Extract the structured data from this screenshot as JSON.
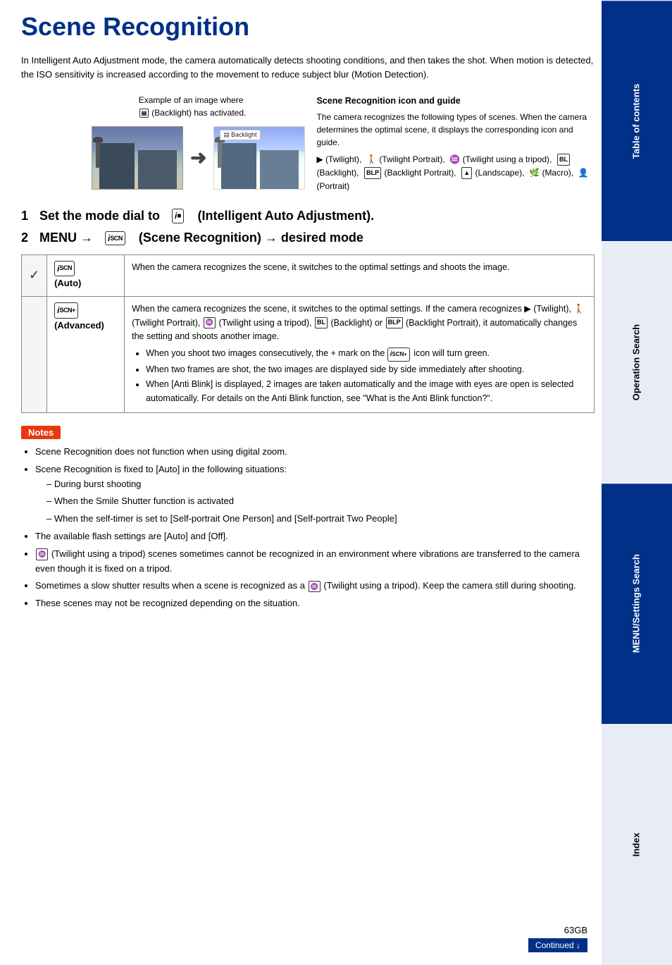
{
  "page": {
    "title": "Scene Recognition",
    "intro": "In Intelligent Auto Adjustment mode, the camera automatically detects shooting conditions, and then takes the shot. When motion is detected, the ISO sensitivity is increased according to the movement to reduce subject blur (Motion Detection).",
    "example_label_line1": "Example of an image where",
    "example_label_line2": "(Backlight) has activated.",
    "sr_box_title": "Scene Recognition icon and guide",
    "sr_box_text": "The camera recognizes the following types of scenes. When the camera determines the optimal scene, it displays the corresponding icon and guide.",
    "sr_box_icons": "(Twilight), (Twilight Portrait), (Twilight using a tripod), (Backlight), (Backlight Portrait), (Landscape), (Macro), (Portrait)",
    "step1": "Set the mode dial to",
    "step1_label": "(Intelligent Auto Adjustment).",
    "step2": "MENU →",
    "step2_label": "(Scene Recognition) → desired mode",
    "table": {
      "rows": [
        {
          "checkmark": "✔",
          "icon_label": "i SCN (Auto)",
          "description": "When the camera recognizes the scene, it switches to the optimal settings and shoots the image."
        },
        {
          "checkmark": "",
          "icon_label": "i SCN+ (Advanced)",
          "description": "When the camera recognizes the scene, it switches to the optimal settings. If the camera recognizes (Twilight), (Twilight Portrait), (Twilight using a tripod), (Backlight) or (Backlight Portrait), it automatically changes the setting and shoots another image.",
          "bullets": [
            "When you shoot two images consecutively, the + mark on the i SCN+ icon will turn green.",
            "When two frames are shot, the two images are displayed side by side immediately after shooting.",
            "When [Anti Blink] is displayed, 2 images are taken automatically and the image with eyes are open is selected automatically. For details on the Anti Blink function, see \"What is the Anti Blink function?\"."
          ]
        }
      ]
    },
    "notes_badge": "Notes",
    "notes": [
      "Scene Recognition does not function when using digital zoom.",
      "Scene Recognition is fixed to [Auto] in the following situations:",
      "(Twilight using a tripod) scenes sometimes cannot be recognized in an environment where vibrations are transferred to the camera even though it is fixed on a tripod.",
      "Sometimes a slow shutter results when a scene is recognized as a (Twilight using a tripod). Keep the camera still during shooting.",
      "These scenes may not be recognized depending on the situation."
    ],
    "notes_sub": [
      "During burst shooting",
      "When the Smile Shutter function is activated",
      "When the self-timer is set to [Self-portrait One Person] and [Self-portrait Two People]"
    ],
    "notes_available_flash": "The available flash settings are [Auto] and [Off].",
    "page_number": "63GB",
    "continued": "Continued ↓"
  },
  "sidebar": {
    "tabs": [
      {
        "label": "Table of contents"
      },
      {
        "label": "Operation Search"
      },
      {
        "label": "MENU/Settings Search"
      },
      {
        "label": "Index"
      }
    ]
  }
}
